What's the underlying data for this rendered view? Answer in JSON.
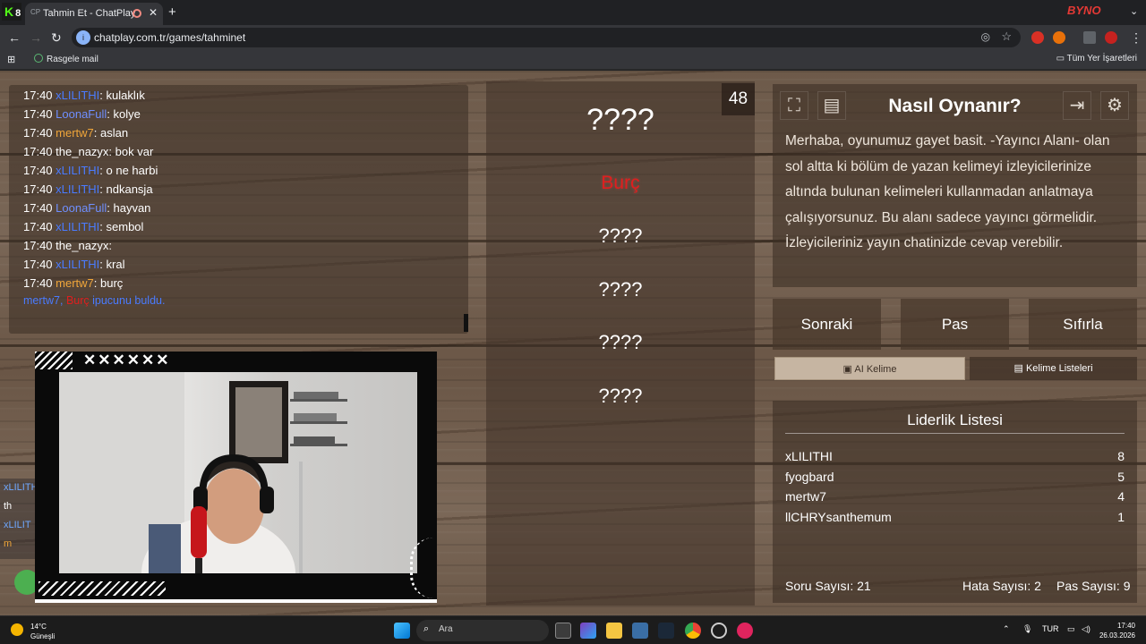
{
  "browser": {
    "tab_title": "Tahmin Et - ChatPlay",
    "url": "chatplay.com.tr/games/tahminet",
    "bookmark": "Rasgele mail",
    "all_bookmarks": "Tüm Yer İşaretleri",
    "app_logo": "K",
    "app_logo_num": "8"
  },
  "chat": {
    "messages": [
      {
        "time": "17:40",
        "user": "xLILITHI",
        "color": "#4a7bff",
        "text": ": kulaklık"
      },
      {
        "time": "17:40",
        "user": "LoonaFull",
        "color": "#6f8fff",
        "text": ": kolye"
      },
      {
        "time": "17:40",
        "user": "mertw7",
        "color": "#f0a63a",
        "text": ": aslan"
      },
      {
        "time": "17:40",
        "user": "the_nazyx",
        "color": "#ffffff",
        "text": ": bok var"
      },
      {
        "time": "17:40",
        "user": "xLILITHI",
        "color": "#4a7bff",
        "text": ": o ne harbi"
      },
      {
        "time": "17:40",
        "user": "xLILITHI",
        "color": "#4a7bff",
        "text": ": ndkansja"
      },
      {
        "time": "17:40",
        "user": "LoonaFull",
        "color": "#6f8fff",
        "text": ": hayvan"
      },
      {
        "time": "17:40",
        "user": "xLILITHI",
        "color": "#4a7bff",
        "text": ": sembol"
      },
      {
        "time": "17:40",
        "user": "the_nazyx",
        "color": "#ffffff",
        "text": ":"
      },
      {
        "time": "17:40",
        "user": "xLILITHI",
        "color": "#4a7bff",
        "text": ": kral"
      },
      {
        "time": "17:40",
        "user": "mertw7",
        "color": "#f0a63a",
        "text": ": burç"
      }
    ],
    "hint": {
      "user": "mertw7,",
      "word": "Burç",
      "text": "ipucunu buldu."
    }
  },
  "cam": {
    "xs": "✕✕✕✕✕✕"
  },
  "side_peek": [
    "xLILITH",
    "th",
    "xLILIT",
    "m"
  ],
  "game": {
    "timer": "48",
    "main_word": "????",
    "revealed": "Burç",
    "hidden": [
      "????",
      "????",
      "????",
      "????"
    ]
  },
  "info": {
    "title": "Nasıl Oynanır?",
    "text": "Merhaba, oyunumuz gayet basit. -Yayıncı Alanı- olan sol altta ki bölüm de yazan kelimeyi izleyicilerinize altında bulunan kelimeleri kullanmadan anlatmaya çalışıyorsunuz. Bu alanı sadece yayıncı görmelidir. İzleyicileriniz yayın chatinizde cevap verebilir."
  },
  "actions": {
    "next": "Sonraki",
    "pass": "Pas",
    "reset": "Sıfırla"
  },
  "tabs": {
    "ai": "AI Kelime",
    "lists": "Kelime Listeleri"
  },
  "leaderboard": {
    "title": "Liderlik Listesi",
    "rows": [
      {
        "name": "xLILITHI",
        "score": "8"
      },
      {
        "name": "fyogbard",
        "score": "5"
      },
      {
        "name": "mertw7",
        "score": "4"
      },
      {
        "name": "llCHRYsanthemum",
        "score": "1"
      }
    ],
    "questions": "Soru Sayısı: 21",
    "errors": "Hata Sayısı: 2",
    "passes": "Pas Sayısı: 9"
  },
  "taskbar": {
    "temp": "14°C",
    "weather": "Güneşli",
    "search": "Ara",
    "lang": "TUR",
    "time": "17:40",
    "date": "26.03.2026"
  },
  "colors": {
    "hint_red": "#e01e1e",
    "accent_blue": "#4a7bff"
  }
}
